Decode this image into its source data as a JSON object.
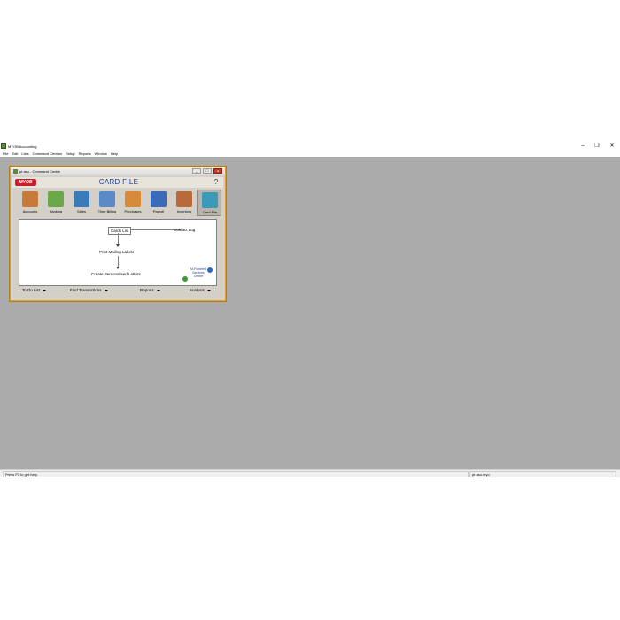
{
  "app": {
    "title": "MYOB Accounting",
    "window_controls": {
      "minimize": "–",
      "restore": "❐",
      "close": "✕"
    }
  },
  "menubar": [
    "File",
    "Edit",
    "Lists",
    "Command Centres",
    "Setup",
    "Reports",
    "Window",
    "Help"
  ],
  "command_centre": {
    "window_title": "pt asu - Command Centre",
    "logo": "MYOB",
    "heading": "CARD FILE",
    "help_glyph": "?",
    "buttons": {
      "min": "_",
      "max": "□",
      "close": "x"
    },
    "icons": [
      {
        "label": "Accounts",
        "icon": "accounts-icon",
        "color": "#c87a3a"
      },
      {
        "label": "Banking",
        "icon": "banking-icon",
        "color": "#6aa84a"
      },
      {
        "label": "Sales",
        "icon": "sales-icon",
        "color": "#3a7ab8"
      },
      {
        "label": "Time Billing",
        "icon": "time-billing-icon",
        "color": "#5a8ac8"
      },
      {
        "label": "Purchases",
        "icon": "purchases-icon",
        "color": "#d88a3a"
      },
      {
        "label": "Payroll",
        "icon": "payroll-icon",
        "color": "#3a6ab8"
      },
      {
        "label": "Inventory",
        "icon": "inventory-icon",
        "color": "#b86a3a"
      },
      {
        "label": "Card File",
        "icon": "card-file-icon",
        "color": "#3a9ab8",
        "active": true
      }
    ],
    "links": {
      "cards_list": "Cards List",
      "contact_log": "Contact Log",
      "print_mailing_labels": "Print Mailing Labels",
      "create_letters": "Create Personalised Letters"
    },
    "badge": "M-Powered Services Centre",
    "bottom": [
      "To Do List",
      "Find Transactions",
      "Reports",
      "Analysis"
    ]
  },
  "statusbar": {
    "help": "Press F1 to get help.",
    "file": "pt asu.myo"
  }
}
